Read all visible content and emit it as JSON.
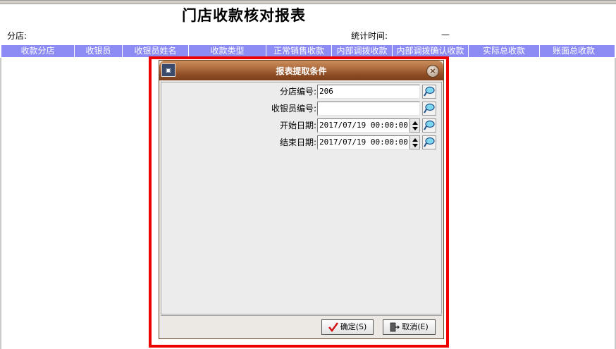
{
  "report": {
    "title": "门店收款核对报表",
    "branch_label": "分店:",
    "stat_time_label": "统计时间:",
    "stat_time_sep": "—"
  },
  "grid": {
    "columns": [
      "收款分店",
      "收银员",
      "收银员姓名",
      "收款类型",
      "正常销售收款",
      "内部调拨收款",
      "内部调拨确认收款",
      "实际总收款",
      "账面总收款"
    ]
  },
  "dialog": {
    "title": "报表提取条件",
    "icon": "app-icon",
    "fields": {
      "branch_code": {
        "label": "分店编号:",
        "value": "206"
      },
      "cashier_code": {
        "label": "收银员编号:",
        "value": ""
      },
      "start_date": {
        "label": "开始日期:",
        "value": "2017/07/19 00:00:00"
      },
      "end_date": {
        "label": "结束日期:",
        "value": "2017/07/19 00:00:00"
      }
    },
    "ok_label": "确定(S)",
    "cancel_label": "取消(E)"
  },
  "colors": {
    "grid_header": "#8c8cf4",
    "titlebar": "#a8653a",
    "highlight": "#ee0000"
  }
}
